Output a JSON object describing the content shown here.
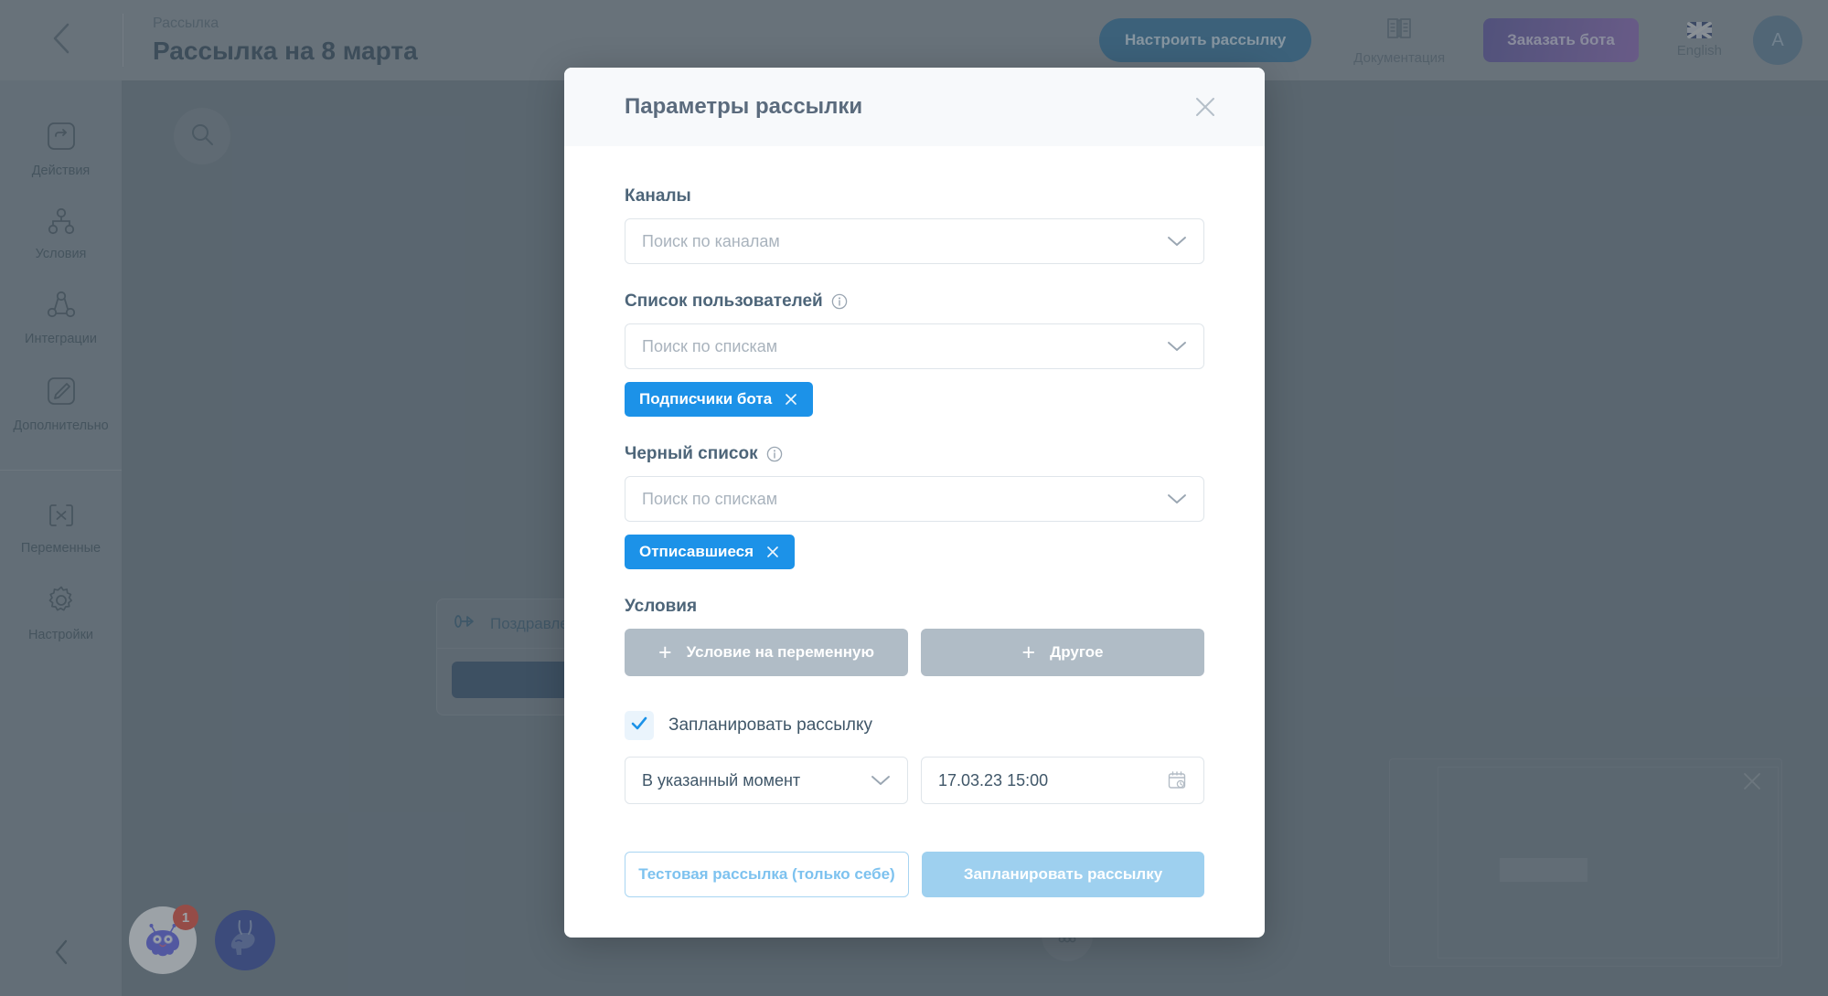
{
  "header": {
    "back_icon": "chevron-left-icon",
    "breadcrumb": "Рассылка",
    "title": "Рассылка на 8 марта",
    "configure_button": "Настроить рассылку",
    "docs_label": "Документация",
    "docs_icon": "book-icon",
    "order_bot_button": "Заказать бота",
    "language_label": "English",
    "language_icon": "uk-flag-icon",
    "avatar_initial": "A"
  },
  "sidebar": {
    "items": [
      {
        "label": "Действия",
        "icon": "action-arrow-icon"
      },
      {
        "label": "Условия",
        "icon": "branch-icon"
      },
      {
        "label": "Интеграции",
        "icon": "integrations-icon"
      },
      {
        "label": "Дополнительно",
        "icon": "pencil-square-icon"
      }
    ],
    "items_secondary": [
      {
        "label": "Переменные",
        "icon": "variable-brackets-icon"
      },
      {
        "label": "Настройки",
        "icon": "gear-icon"
      }
    ],
    "collapse_icon": "chevron-left-icon"
  },
  "canvas": {
    "search_icon": "search-icon",
    "node": {
      "icon": "message-node-icon",
      "title": "Поздравле"
    },
    "zoom_control_icon": "zoom-handle-icon",
    "ghost_panel_close_icon": "close-icon",
    "chat_widget": {
      "bot_icon": "bot-avatar-icon",
      "badge_count": "1",
      "llama_icon": "llama-avatar-icon"
    }
  },
  "modal": {
    "title": "Параметры рассылки",
    "close_icon": "close-icon",
    "channels": {
      "label": "Каналы",
      "placeholder": "Поиск по каналам",
      "caret_icon": "chevron-down-icon"
    },
    "user_list": {
      "label": "Список пользователей",
      "info_icon": "info-circle-icon",
      "placeholder": "Поиск по спискам",
      "caret_icon": "chevron-down-icon",
      "chips": [
        {
          "label": "Подписчики бота",
          "remove_icon": "close-icon"
        }
      ]
    },
    "blacklist": {
      "label": "Черный список",
      "info_icon": "info-circle-icon",
      "placeholder": "Поиск по спискам",
      "caret_icon": "chevron-down-icon",
      "chips": [
        {
          "label": "Отписавшиеся",
          "remove_icon": "close-icon"
        }
      ]
    },
    "conditions": {
      "label": "Условия",
      "buttons": [
        {
          "label": "Условие на переменную",
          "icon": "plus-icon"
        },
        {
          "label": "Другое",
          "icon": "plus-icon"
        }
      ]
    },
    "schedule": {
      "checkbox_label": "Запланировать рассылку",
      "checkbox_checked": true,
      "checkbox_icon": "check-icon",
      "mode_value": "В указанный момент",
      "mode_caret_icon": "chevron-down-icon",
      "datetime_value": "17.03.23 15:00",
      "calendar_icon": "calendar-clock-icon"
    },
    "footer": {
      "test_button": "Тестовая рассылка (только себе)",
      "schedule_button": "Запланировать рассылку"
    }
  },
  "colors": {
    "chip_blue": "#1c92e8",
    "header_button_blue": "#2b6f9c",
    "order_bot_purple": "#7a5cae",
    "badge_red": "#f0422a",
    "schedule_button": "#9ed0ef"
  }
}
